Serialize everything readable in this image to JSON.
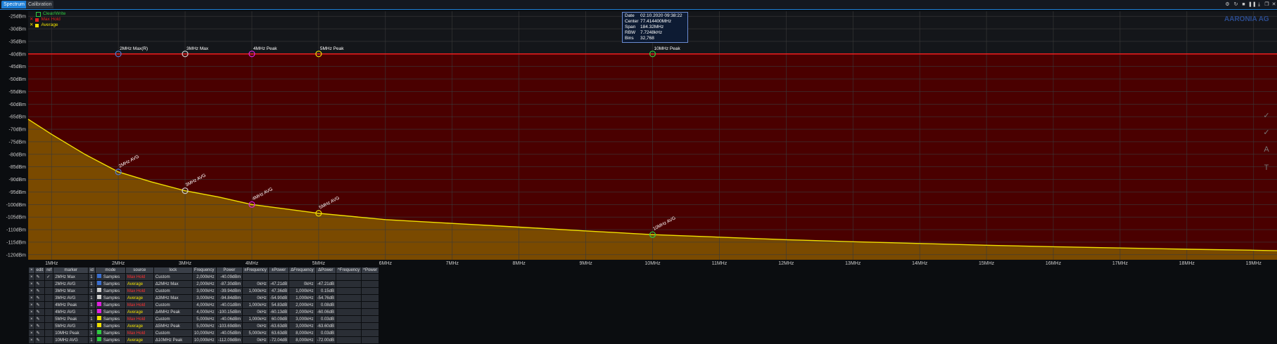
{
  "tabs": [
    {
      "label": "Spectrum",
      "active": true
    },
    {
      "label": "Calibration",
      "active": false
    }
  ],
  "window_icons": [
    "gear-icon",
    "refresh-icon",
    "stop-icon",
    "pause-icon",
    "download-icon",
    "restore-icon",
    "close-icon"
  ],
  "legend": [
    {
      "label": "Clear/Write",
      "color": "#2ecc40",
      "checked": false
    },
    {
      "label": "Max Hold",
      "color": "#e02020",
      "checked": true
    },
    {
      "label": "Average",
      "color": "#f0e000",
      "checked": true
    }
  ],
  "info_box": {
    "rows": [
      {
        "key": "Date",
        "value": "02.10.2020 09:38:22"
      },
      {
        "key": "Center",
        "value": "77.414400MHz"
      },
      {
        "key": "Span",
        "value": "184.32MHz"
      },
      {
        "key": "RBW",
        "value": "7.7248kHz"
      },
      {
        "key": "Bins",
        "value": "32,768"
      }
    ]
  },
  "logo": "AARONIA AG",
  "chart_data": {
    "type": "line",
    "yunit": "dBm",
    "ylim": [
      -122,
      -23
    ],
    "xlim": [
      0.65,
      19.35
    ],
    "y_ticks": [
      "-25dBm",
      "-30dBm",
      "-35dBm",
      "-40dBm",
      "-45dBm",
      "-50dBm",
      "-55dBm",
      "-60dBm",
      "-65dBm",
      "-70dBm",
      "-75dBm",
      "-80dBm",
      "-85dBm",
      "-90dBm",
      "-95dBm",
      "-100dBm",
      "-105dBm",
      "-110dBm",
      "-115dBm",
      "-120dBm"
    ],
    "y_tick_values": [
      -25,
      -30,
      -35,
      -40,
      -45,
      -50,
      -55,
      -60,
      -65,
      -70,
      -75,
      -80,
      -85,
      -90,
      -95,
      -100,
      -105,
      -110,
      -115,
      -120
    ],
    "x_ticks": [
      "1MHz",
      "2MHz",
      "3MHz",
      "4MHz",
      "5MHz",
      "6MHz",
      "7MHz",
      "8MHz",
      "9MHz",
      "10MHz",
      "11MHz",
      "12MHz",
      "13MHz",
      "14MHz",
      "15MHz",
      "16MHz",
      "17MHz",
      "18MHz",
      "19MHz"
    ],
    "x_tick_values": [
      1,
      2,
      3,
      4,
      5,
      6,
      7,
      8,
      9,
      10,
      11,
      12,
      13,
      14,
      15,
      16,
      17,
      18,
      19
    ],
    "grid": true,
    "series": [
      {
        "name": "Max Hold",
        "color": "#ff2020",
        "fill": "#4a0000",
        "x": [
          0.65,
          2,
          3,
          4,
          5,
          10,
          19.35
        ],
        "values": [
          -40,
          -40,
          -40,
          -40,
          -40,
          -40,
          -40
        ]
      },
      {
        "name": "Average",
        "color": "#f0e000",
        "fill": "#7a4a00",
        "x": [
          0.65,
          1,
          1.5,
          2,
          2.5,
          3,
          3.5,
          4,
          5,
          6,
          7,
          8,
          9,
          10,
          11,
          12,
          13,
          14,
          15,
          16,
          17,
          18,
          19,
          19.35
        ],
        "values": [
          -66,
          -72,
          -80,
          -87,
          -91,
          -94.5,
          -97,
          -100,
          -103.5,
          -106,
          -107.5,
          -109,
          -110.5,
          -112,
          -113,
          -114,
          -114.8,
          -115.5,
          -116.2,
          -116.8,
          -117.3,
          -117.8,
          -118.2,
          -118.4
        ]
      }
    ],
    "markers": [
      {
        "label": "2MHz Max(R)",
        "x": 2,
        "y": -40,
        "color": "#4a7bd8"
      },
      {
        "label": "3MHz  Max",
        "x": 3,
        "y": -40,
        "color": "#cfcfcf"
      },
      {
        "label": "4MHz Peak",
        "x": 4,
        "y": -40,
        "color": "#e020e0"
      },
      {
        "label": "5MHz Peak",
        "x": 5,
        "y": -40,
        "color": "#f0e000"
      },
      {
        "label": "10MHz Peak",
        "x": 10,
        "y": -40,
        "color": "#2ecc40"
      },
      {
        "label": "2MHz AVG",
        "x": 2,
        "y": -87,
        "color": "#4a7bd8"
      },
      {
        "label": "3MHz AVG",
        "x": 3,
        "y": -94.5,
        "color": "#cfcfcf"
      },
      {
        "label": "4MHz AVG",
        "x": 4,
        "y": -100,
        "color": "#e020e0"
      },
      {
        "label": "5MHz AVG",
        "x": 5,
        "y": -103.5,
        "color": "#f0e000"
      },
      {
        "label": "10MHz AVG",
        "x": 10,
        "y": -112,
        "color": "#2ecc40"
      }
    ]
  },
  "marker_table": {
    "headers": [
      "edit",
      "ref",
      "marker",
      "id",
      "mode",
      "source",
      "lock",
      "Frequency",
      "Power",
      "±Frequency",
      "±Power",
      "ΔFrequency",
      "ΔPower",
      "^Frequency",
      "^Power"
    ],
    "rows": [
      {
        "ref": "✓",
        "marker": "2MHz Max",
        "id": "1",
        "color": "#3a6fd0",
        "mode": "Samples",
        "source": "Max Hold",
        "source_color": "#ff3030",
        "lock": "Custom",
        "freq": "2,000kHz",
        "power": "-40.09dBm",
        "pfreq": "",
        "ppower": "",
        "dfreq": "",
        "dpower": ""
      },
      {
        "ref": "",
        "marker": "2MHz AVG",
        "id": "1",
        "color": "#3a6fd0",
        "mode": "Samples",
        "source": "Average",
        "source_color": "#f0e000",
        "lock": "Δ2MHz Max",
        "freq": "2,000kHz",
        "power": "-87.30dBm",
        "pfreq": "0kHz",
        "ppower": "-47.21dB",
        "dfreq": "0kHz",
        "dpower": "-47.21dB"
      },
      {
        "ref": "",
        "marker": "3MHz Max",
        "id": "1",
        "color": "#cfcfcf",
        "mode": "Samples",
        "source": "Max Hold",
        "source_color": "#ff3030",
        "lock": "Custom",
        "freq": "3,000kHz",
        "power": "-39.94dBm",
        "pfreq": "1,000kHz",
        "ppower": "47.36dB",
        "dfreq": "1,000kHz",
        "dpower": "0.15dB"
      },
      {
        "ref": "",
        "marker": "3MHz AVG",
        "id": "1",
        "color": "#cfcfcf",
        "mode": "Samples",
        "source": "Average",
        "source_color": "#f0e000",
        "lock": "Δ3MHz Max",
        "freq": "3,000kHz",
        "power": "-94.84dBm",
        "pfreq": "0kHz",
        "ppower": "-54.90dB",
        "dfreq": "1,000kHz",
        "dpower": "-54.76dB"
      },
      {
        "ref": "",
        "marker": "4MHz Peak",
        "id": "1",
        "color": "#e020e0",
        "mode": "Samples",
        "source": "Max Hold",
        "source_color": "#ff3030",
        "lock": "Custom",
        "freq": "4,000kHz",
        "power": "-40.01dBm",
        "pfreq": "1,000kHz",
        "ppower": "54.83dB",
        "dfreq": "2,000kHz",
        "dpower": "0.08dB"
      },
      {
        "ref": "",
        "marker": "4MHz AVG",
        "id": "1",
        "color": "#e020e0",
        "mode": "Samples",
        "source": "Average",
        "source_color": "#f0e000",
        "lock": "Δ4MHz Peak",
        "freq": "4,000kHz",
        "power": "-100.15dBm",
        "pfreq": "0kHz",
        "ppower": "-60.13dB",
        "dfreq": "2,000kHz",
        "dpower": "-60.06dB"
      },
      {
        "ref": "",
        "marker": "5MHz Peak",
        "id": "1",
        "color": "#f0e000",
        "mode": "Samples",
        "source": "Max Hold",
        "source_color": "#ff3030",
        "lock": "Custom",
        "freq": "5,000kHz",
        "power": "-40.06dBm",
        "pfreq": "1,000kHz",
        "ppower": "60.09dB",
        "dfreq": "3,000kHz",
        "dpower": "0.03dB"
      },
      {
        "ref": "",
        "marker": "5MHz AVG",
        "id": "1",
        "color": "#f0e000",
        "mode": "Samples",
        "source": "Average",
        "source_color": "#f0e000",
        "lock": "Δ5MHz Peak",
        "freq": "5,000kHz",
        "power": "-103.69dBm",
        "pfreq": "0kHz",
        "ppower": "-63.63dB",
        "dfreq": "3,000kHz",
        "dpower": "-63.60dB"
      },
      {
        "ref": "",
        "marker": "10MHz Peak",
        "id": "1",
        "color": "#2ecc40",
        "mode": "Samples",
        "source": "Max Hold",
        "source_color": "#ff3030",
        "lock": "Custom",
        "freq": "10,000kHz",
        "power": "-40.05dBm",
        "pfreq": "5,000kHz",
        "ppower": "63.63dB",
        "dfreq": "8,000kHz",
        "dpower": "0.03dB"
      },
      {
        "ref": "",
        "marker": "10MHz AVG",
        "id": "1",
        "color": "#2ecc40",
        "mode": "Samples",
        "source": "Average",
        "source_color": "#f0e000",
        "lock": "Δ10MHz Peak",
        "freq": "10,000kHz",
        "power": "-112.09dBm",
        "pfreq": "0kHz",
        "ppower": "-72.04dB",
        "dfreq": "8,000kHz",
        "dpower": "-72.00dB"
      }
    ]
  }
}
